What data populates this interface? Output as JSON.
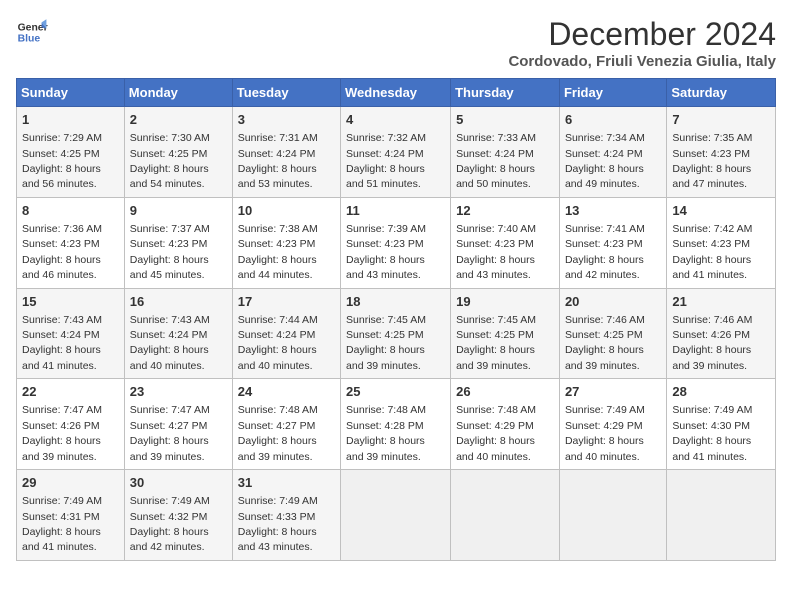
{
  "logo": {
    "line1": "General",
    "line2": "Blue"
  },
  "title": "December 2024",
  "subtitle": "Cordovado, Friuli Venezia Giulia, Italy",
  "headers": [
    "Sunday",
    "Monday",
    "Tuesday",
    "Wednesday",
    "Thursday",
    "Friday",
    "Saturday"
  ],
  "weeks": [
    [
      {
        "day": "1",
        "sunrise": "7:29 AM",
        "sunset": "4:25 PM",
        "daylight": "8 hours and 56 minutes."
      },
      {
        "day": "2",
        "sunrise": "7:30 AM",
        "sunset": "4:25 PM",
        "daylight": "8 hours and 54 minutes."
      },
      {
        "day": "3",
        "sunrise": "7:31 AM",
        "sunset": "4:24 PM",
        "daylight": "8 hours and 53 minutes."
      },
      {
        "day": "4",
        "sunrise": "7:32 AM",
        "sunset": "4:24 PM",
        "daylight": "8 hours and 51 minutes."
      },
      {
        "day": "5",
        "sunrise": "7:33 AM",
        "sunset": "4:24 PM",
        "daylight": "8 hours and 50 minutes."
      },
      {
        "day": "6",
        "sunrise": "7:34 AM",
        "sunset": "4:24 PM",
        "daylight": "8 hours and 49 minutes."
      },
      {
        "day": "7",
        "sunrise": "7:35 AM",
        "sunset": "4:23 PM",
        "daylight": "8 hours and 47 minutes."
      }
    ],
    [
      {
        "day": "8",
        "sunrise": "7:36 AM",
        "sunset": "4:23 PM",
        "daylight": "8 hours and 46 minutes."
      },
      {
        "day": "9",
        "sunrise": "7:37 AM",
        "sunset": "4:23 PM",
        "daylight": "8 hours and 45 minutes."
      },
      {
        "day": "10",
        "sunrise": "7:38 AM",
        "sunset": "4:23 PM",
        "daylight": "8 hours and 44 minutes."
      },
      {
        "day": "11",
        "sunrise": "7:39 AM",
        "sunset": "4:23 PM",
        "daylight": "8 hours and 43 minutes."
      },
      {
        "day": "12",
        "sunrise": "7:40 AM",
        "sunset": "4:23 PM",
        "daylight": "8 hours and 43 minutes."
      },
      {
        "day": "13",
        "sunrise": "7:41 AM",
        "sunset": "4:23 PM",
        "daylight": "8 hours and 42 minutes."
      },
      {
        "day": "14",
        "sunrise": "7:42 AM",
        "sunset": "4:23 PM",
        "daylight": "8 hours and 41 minutes."
      }
    ],
    [
      {
        "day": "15",
        "sunrise": "7:43 AM",
        "sunset": "4:24 PM",
        "daylight": "8 hours and 41 minutes."
      },
      {
        "day": "16",
        "sunrise": "7:43 AM",
        "sunset": "4:24 PM",
        "daylight": "8 hours and 40 minutes."
      },
      {
        "day": "17",
        "sunrise": "7:44 AM",
        "sunset": "4:24 PM",
        "daylight": "8 hours and 40 minutes."
      },
      {
        "day": "18",
        "sunrise": "7:45 AM",
        "sunset": "4:25 PM",
        "daylight": "8 hours and 39 minutes."
      },
      {
        "day": "19",
        "sunrise": "7:45 AM",
        "sunset": "4:25 PM",
        "daylight": "8 hours and 39 minutes."
      },
      {
        "day": "20",
        "sunrise": "7:46 AM",
        "sunset": "4:25 PM",
        "daylight": "8 hours and 39 minutes."
      },
      {
        "day": "21",
        "sunrise": "7:46 AM",
        "sunset": "4:26 PM",
        "daylight": "8 hours and 39 minutes."
      }
    ],
    [
      {
        "day": "22",
        "sunrise": "7:47 AM",
        "sunset": "4:26 PM",
        "daylight": "8 hours and 39 minutes."
      },
      {
        "day": "23",
        "sunrise": "7:47 AM",
        "sunset": "4:27 PM",
        "daylight": "8 hours and 39 minutes."
      },
      {
        "day": "24",
        "sunrise": "7:48 AM",
        "sunset": "4:27 PM",
        "daylight": "8 hours and 39 minutes."
      },
      {
        "day": "25",
        "sunrise": "7:48 AM",
        "sunset": "4:28 PM",
        "daylight": "8 hours and 39 minutes."
      },
      {
        "day": "26",
        "sunrise": "7:48 AM",
        "sunset": "4:29 PM",
        "daylight": "8 hours and 40 minutes."
      },
      {
        "day": "27",
        "sunrise": "7:49 AM",
        "sunset": "4:29 PM",
        "daylight": "8 hours and 40 minutes."
      },
      {
        "day": "28",
        "sunrise": "7:49 AM",
        "sunset": "4:30 PM",
        "daylight": "8 hours and 41 minutes."
      }
    ],
    [
      {
        "day": "29",
        "sunrise": "7:49 AM",
        "sunset": "4:31 PM",
        "daylight": "8 hours and 41 minutes."
      },
      {
        "day": "30",
        "sunrise": "7:49 AM",
        "sunset": "4:32 PM",
        "daylight": "8 hours and 42 minutes."
      },
      {
        "day": "31",
        "sunrise": "7:49 AM",
        "sunset": "4:33 PM",
        "daylight": "8 hours and 43 minutes."
      },
      null,
      null,
      null,
      null
    ]
  ],
  "labels": {
    "sunrise": "Sunrise:",
    "sunset": "Sunset:",
    "daylight": "Daylight:"
  }
}
